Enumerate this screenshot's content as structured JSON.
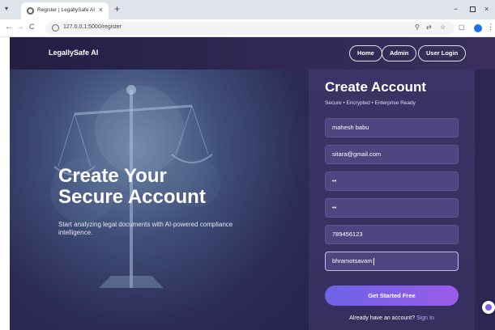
{
  "browser": {
    "tab_title": "Register | LegallySafe AI",
    "tab_close": "×",
    "new_tab": "+",
    "url": "127.0.0.1:5000/register",
    "back": "←",
    "forward": "→",
    "reload": "C",
    "minimize": "−",
    "close": "×",
    "menu_toggle": "▾"
  },
  "header": {
    "brand": "LegallySafe AI",
    "nav": [
      "Home",
      "Admin",
      "User Login"
    ]
  },
  "hero": {
    "title_line1": "Create Your",
    "title_line2": "Secure Account",
    "subtitle": "Start analyzing legal documents with AI-powered compliance intelligence."
  },
  "form": {
    "title": "Create Account",
    "subtitle": "Secure • Encrypted • Enterprise Ready",
    "fields": {
      "name": "mahesh babu",
      "email": "sitara@gmail.com",
      "password": "••",
      "confirm_password": "••",
      "phone": "789456123",
      "location": "bhramotsavam"
    },
    "submit_label": "Get Started Free",
    "signin_prompt": "Already have an account?",
    "signin_link": "Sign In"
  },
  "icons": {
    "tab_menu": "chevron-down-icon",
    "favicon": "globe-icon",
    "site_info": "info-icon",
    "translate": "translate-icon",
    "bookmark": "star-icon",
    "extensions": "puzzle-icon",
    "profile": "profile-icon",
    "more": "kebab-menu-icon",
    "chat": "chat-assistant-icon"
  },
  "colors": {
    "page_bg": "#2a2550",
    "panel_bg": "#3b3466",
    "input_bg": "#4e4680",
    "button_start": "#6c63e6",
    "button_end": "#9a5ce8",
    "link": "#b6b0ff"
  }
}
